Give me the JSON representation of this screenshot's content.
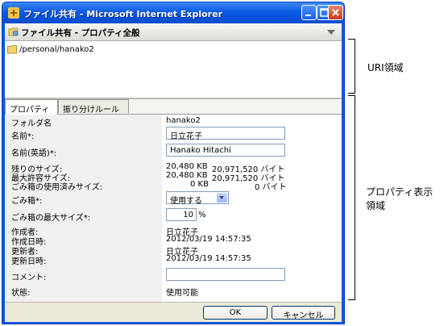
{
  "window": {
    "title": "ファイル共有 - Microsoft Internet Explorer"
  },
  "header": {
    "title": "ファイル共有 - プロパティ全般"
  },
  "uri": {
    "path": "/personal/hanako2"
  },
  "tabs": [
    {
      "label": "プロパティ",
      "active": true
    },
    {
      "label": "振り分けルール",
      "active": false
    }
  ],
  "properties": {
    "folder_name": {
      "label": "フォルダ名",
      "value": "hanako2"
    },
    "name": {
      "label": "名前*:",
      "value": "日立花子"
    },
    "name_en": {
      "label": "名前(英語)*:",
      "value": "Hanako Hitachi"
    },
    "remaining": {
      "label": "残りのサイズ:",
      "kb": "20,480 KB",
      "bytes": "20,971,520 バイト"
    },
    "max_allowed": {
      "label": "最大許容サイズ:",
      "kb": "20,480 KB",
      "bytes": "20,971,520 バイト"
    },
    "trash_used": {
      "label": "ごみ箱の使用済みサイズ:",
      "kb": "0 KB",
      "bytes": "0 バイト"
    },
    "trash": {
      "label": "ごみ箱*:",
      "selected": "使用する"
    },
    "trash_max": {
      "label": "ごみ箱の最大サイズ*:",
      "value": "10",
      "unit": "%"
    },
    "creator": {
      "label": "作成者:",
      "value": "日立花子"
    },
    "created": {
      "label": "作成日時:",
      "value": "2012/03/19 14:57:35"
    },
    "updater": {
      "label": "更新者:",
      "value": "日立花子"
    },
    "updated": {
      "label": "更新日時:",
      "value": "2012/03/19 14:57:35"
    },
    "comment": {
      "label": "コメント:",
      "value": ""
    },
    "status": {
      "label": "状態:",
      "value": "使用可能"
    }
  },
  "buttons": {
    "ok": "OK",
    "cancel": "キャンセル"
  },
  "annotations": {
    "uri_area": "URI領域",
    "property_area_line1": "プロパティ表示",
    "property_area_line2": "領域"
  },
  "icons": [
    "ie-icon",
    "minimize-icon",
    "maximize-icon",
    "close-icon",
    "folder-share-icon",
    "dropdown-arrow-icon",
    "folder-icon"
  ]
}
